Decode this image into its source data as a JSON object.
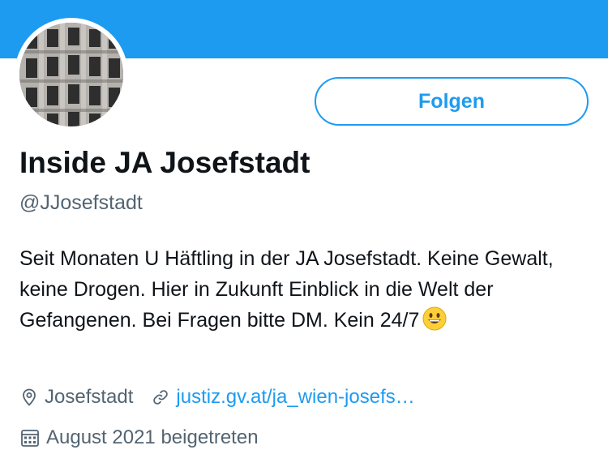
{
  "profile": {
    "display_name": "Inside JA Josefstadt",
    "handle": "@JJosefstadt",
    "follow_label": "Folgen",
    "bio": "Seit Monaten U Häftling in der JA Josefstadt. Keine Gewalt, keine Drogen. Hier in Zukunft Einblick in die Welt der Gefangenen. Bei Fragen bitte DM. Kein 24/7",
    "bio_emoji": "grinning-face-emoji",
    "avatar": "building-facade-photo"
  },
  "meta": {
    "location": "Josefstadt",
    "location_icon": "location-pin-icon",
    "link": "justiz.gv.at/ja_wien-josefs…",
    "link_icon": "link-icon",
    "joined": "August 2021 beigetreten",
    "joined_icon": "calendar-icon"
  },
  "colors": {
    "accent": "#1d9bf0",
    "text": "#0f1419",
    "secondary": "#536471",
    "background": "#ffffff"
  }
}
